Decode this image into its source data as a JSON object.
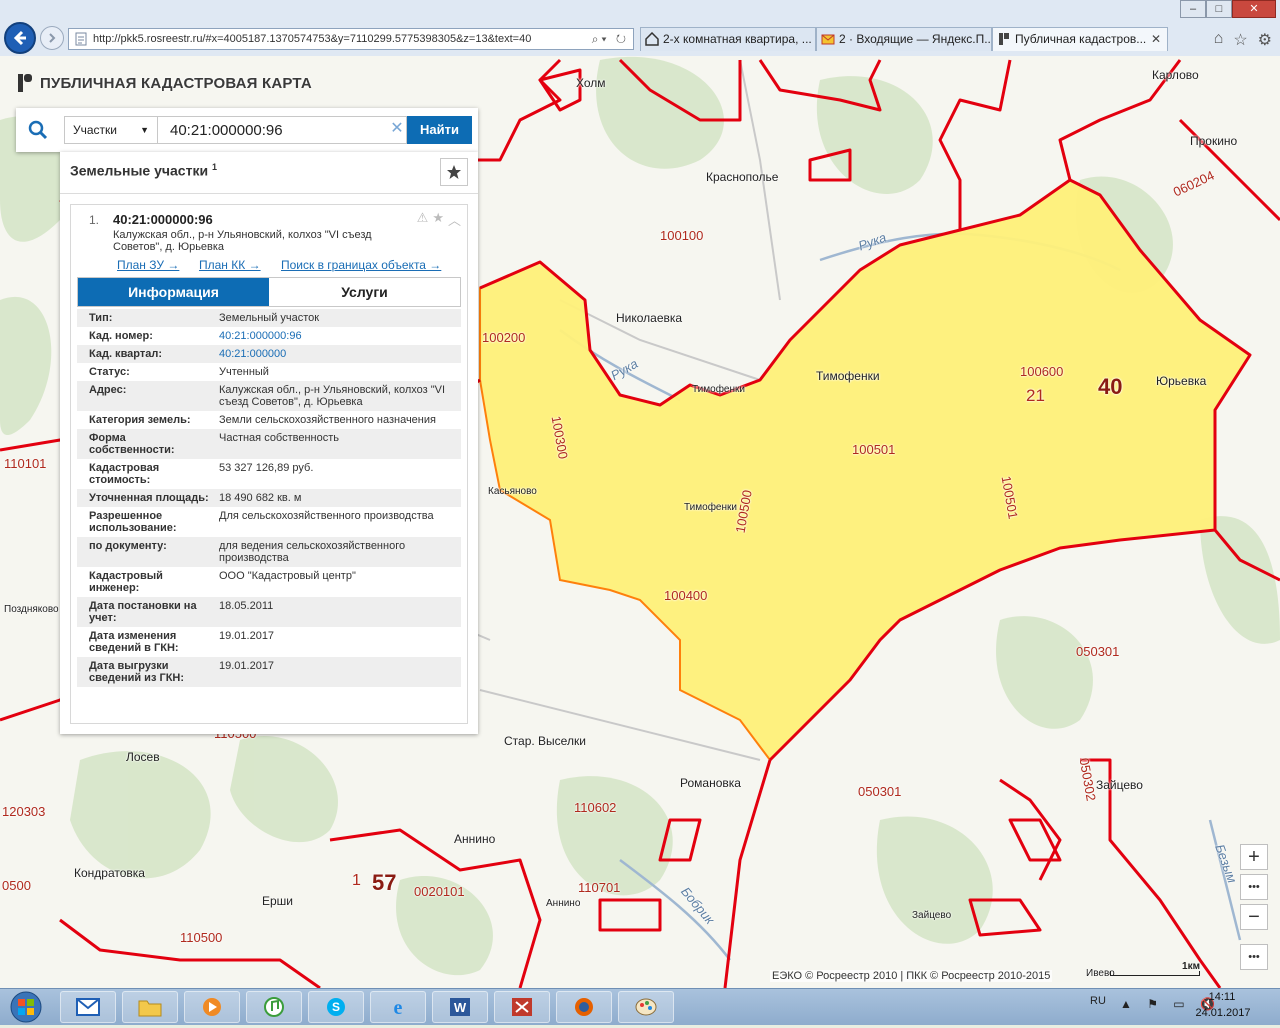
{
  "browser": {
    "url": "http://pkk5.rosreestr.ru/#x=4005187.1370574753&y=7110299.5775398305&z=13&text=40",
    "tabs": [
      {
        "label": "2-х комнатная квартира, ...",
        "icon": "home-icon"
      },
      {
        "label": "2 · Входящие — Яндекс.П...",
        "icon": "mail-icon"
      },
      {
        "label": "Публичная кадастров...",
        "icon": "rosreestr-icon",
        "active": true
      }
    ],
    "window_controls": [
      "–",
      "□",
      "✕"
    ]
  },
  "app": {
    "title": "ПУБЛИЧНАЯ КАДАСТРОВАЯ КАРТА"
  },
  "search": {
    "type_label": "Участки",
    "query": "40:21:000000:96",
    "submit_label": "Найти"
  },
  "result": {
    "heading": "Земельные участки",
    "count": "1",
    "item": {
      "index": "1.",
      "cad_number": "40:21:000000:96",
      "address": "Калужская обл., р-н Ульяновский, колхоз \"VI съезд Советов\", д. Юрьевка",
      "links": {
        "plan_zu": "План ЗУ →",
        "plan_kk": "План КК →",
        "search_within": "Поиск в границах объекта →"
      }
    },
    "tabs": {
      "info": "Информация",
      "services": "Услуги"
    },
    "rows": [
      {
        "key": "Тип:",
        "value": "Земельный участок"
      },
      {
        "key": "Кад. номер:",
        "value": "40:21:000000:96",
        "link": true
      },
      {
        "key": "Кад. квартал:",
        "value": "40:21:000000",
        "link": true
      },
      {
        "key": "Статус:",
        "value": "Учтенный"
      },
      {
        "key": "Адрес:",
        "value": "Калужская обл., р-н Ульяновский, колхоз \"VI съезд Советов\", д. Юрьевка"
      },
      {
        "key": "Категория земель:",
        "value": "Земли сельскохозяйственного назначения"
      },
      {
        "key": "Форма собственности:",
        "value": "Частная собственность"
      },
      {
        "key": "Кадастровая стоимость:",
        "value": "53 327 126,89 руб."
      },
      {
        "key": "Уточненная площадь:",
        "value": "18 490 682 кв. м"
      },
      {
        "key": "Разрешенное использование:",
        "value": "Для сельскохозяйственного производства"
      },
      {
        "key": "по документу:",
        "value": "для ведения сельскохозяйственного производства"
      },
      {
        "key": "Кадастровый инженер:",
        "value": "ООО \"Кадастровый центр\""
      },
      {
        "key": "Дата постановки на учет:",
        "value": "18.05.2011"
      },
      {
        "key": "Дата изменения сведений в ГКН:",
        "value": "19.01.2017"
      },
      {
        "key": "Дата выгрузки сведений из ГКН:",
        "value": "19.01.2017"
      }
    ]
  },
  "map": {
    "colors": {
      "boundary": "#e3000f",
      "parcel_fill": "#fff17a",
      "parcel_border": "#ff7a00",
      "forest": "#d9e7cc",
      "field": "#f7f7f2"
    },
    "labels": [
      {
        "name": "place-holm",
        "text": "Холм",
        "kind": "place"
      },
      {
        "name": "place-karlovo",
        "text": "Карлово",
        "kind": "place"
      },
      {
        "name": "place-prokino",
        "text": "Прокино",
        "kind": "place"
      },
      {
        "name": "place-krasnopolye",
        "text": "Краснополье",
        "kind": "place"
      },
      {
        "name": "place-nikolaevka",
        "text": "Николаевка",
        "kind": "place"
      },
      {
        "name": "place-timofenki",
        "text": "Тимофенки",
        "kind": "place"
      },
      {
        "name": "place-timofenki-2",
        "text": "Тимофенки",
        "kind": "small"
      },
      {
        "name": "place-timofenki-3",
        "text": "Тимофенки",
        "kind": "small"
      },
      {
        "name": "place-yuryevka",
        "text": "Юрьевка",
        "kind": "place"
      },
      {
        "name": "place-kasyanovo",
        "text": "Касьяново",
        "kind": "small"
      },
      {
        "name": "place-pozdnyakovo",
        "text": "Поздняково",
        "kind": "small"
      },
      {
        "name": "place-losev",
        "text": "Лосев",
        "kind": "place"
      },
      {
        "name": "place-star-vyselki",
        "text": "Стар. Выселки",
        "kind": "place"
      },
      {
        "name": "place-romanovka",
        "text": "Романовка",
        "kind": "place"
      },
      {
        "name": "place-annino",
        "text": "Аннино",
        "kind": "place"
      },
      {
        "name": "place-annino-2",
        "text": "Аннино",
        "kind": "small"
      },
      {
        "name": "place-kondratovka",
        "text": "Кондратовка",
        "kind": "place"
      },
      {
        "name": "place-ershi",
        "text": "Ерши",
        "kind": "place"
      },
      {
        "name": "place-zaytsevo",
        "text": "Зайцево",
        "kind": "place"
      },
      {
        "name": "place-zaytsevo-2",
        "text": "Зайцево",
        "kind": "small"
      },
      {
        "name": "place-ivevo",
        "text": "Ивево",
        "kind": "small"
      },
      {
        "name": "river-ruka",
        "text": "Рука",
        "kind": "river"
      },
      {
        "name": "river-ruka-2",
        "text": "Рука",
        "kind": "river"
      },
      {
        "name": "river-bobrik",
        "text": "Бобрик",
        "kind": "river"
      },
      {
        "name": "river-bezymyanny",
        "text": "Безым",
        "kind": "river"
      },
      {
        "name": "code-100100",
        "text": "100100",
        "kind": "code"
      },
      {
        "name": "code-060204",
        "text": "060204",
        "kind": "code"
      },
      {
        "name": "code-100200",
        "text": "100200",
        "kind": "code"
      },
      {
        "name": "code-100300",
        "text": "100300",
        "kind": "code"
      },
      {
        "name": "code-110101",
        "text": "110101",
        "kind": "code"
      },
      {
        "name": "code-100501",
        "text": "100501",
        "kind": "code"
      },
      {
        "name": "code-100501-b",
        "text": "100501",
        "kind": "code"
      },
      {
        "name": "code-100500",
        "text": "100500",
        "kind": "code"
      },
      {
        "name": "code-100600",
        "text": "100600",
        "kind": "code"
      },
      {
        "name": "code-100400",
        "text": "100400",
        "kind": "code"
      },
      {
        "name": "code-050301",
        "text": "050301",
        "kind": "code"
      },
      {
        "name": "code-050301-b",
        "text": "050301",
        "kind": "code"
      },
      {
        "name": "code-050302",
        "text": "050302",
        "kind": "code"
      },
      {
        "name": "code-110602",
        "text": "110602",
        "kind": "code"
      },
      {
        "name": "code-120303",
        "text": "120303",
        "kind": "code"
      },
      {
        "name": "code-0500",
        "text": "0500",
        "kind": "code"
      },
      {
        "name": "code-0020101",
        "text": "0020101",
        "kind": "code"
      },
      {
        "name": "code-110701",
        "text": "110701",
        "kind": "code"
      },
      {
        "name": "code-110500",
        "text": "110500",
        "kind": "code"
      },
      {
        "name": "code-110500-b",
        "text": "110500",
        "kind": "code"
      },
      {
        "name": "district-21",
        "text": "21",
        "kind": "district"
      },
      {
        "name": "district-40",
        "text": "40",
        "kind": "big"
      },
      {
        "name": "district-57",
        "text": "57",
        "kind": "big"
      },
      {
        "name": "district-1",
        "text": "1",
        "kind": "district"
      }
    ],
    "copyright": "ЕЭКО © Росреестр 2010 | ПКК © Росреестр 2010-2015",
    "scale": "1км",
    "zoom_in": "+",
    "zoom_out": "−",
    "more": "•••"
  },
  "taskbar": {
    "items": [
      "outlook-icon",
      "explorer-icon",
      "media-player-icon",
      "itunes-icon",
      "skype-icon",
      "ie-icon",
      "word-icon",
      "scan-icon",
      "firefox-icon",
      "paint-icon"
    ],
    "lang": "RU",
    "time": "14:11",
    "date": "24.01.2017"
  }
}
